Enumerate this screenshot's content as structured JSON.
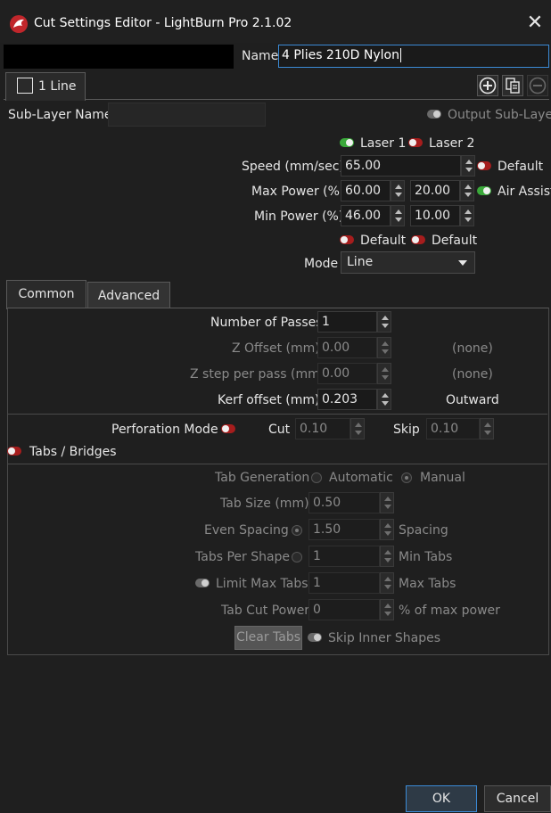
{
  "window": {
    "title": "Cut Settings Editor - LightBurn Pro 2.1.02",
    "close_glyph": "✕"
  },
  "header": {
    "name_label": "Name",
    "name_value": "4 Plies 210D Nylon"
  },
  "layer_tab": {
    "label": "1 Line"
  },
  "sublayer": {
    "name_label": "Sub-Layer Name",
    "name_value": "",
    "output_label": "Output Sub-Layer"
  },
  "lasers": {
    "laser1_label": "Laser 1",
    "laser2_label": "Laser 2"
  },
  "speed": {
    "label": "Speed (mm/sec)",
    "value": "65.00",
    "default_label": "Default"
  },
  "max_power": {
    "label": "Max Power (%)",
    "value1": "60.00",
    "value2": "20.00",
    "air_assist_label": "Air Assist"
  },
  "min_power": {
    "label": "Min Power (%)",
    "value1": "46.00",
    "value2": "10.00"
  },
  "defaults_row": {
    "default1_label": "Default",
    "default2_label": "Default"
  },
  "mode": {
    "label": "Mode",
    "value": "Line"
  },
  "tabs": [
    {
      "label": "Common"
    },
    {
      "label": "Advanced"
    }
  ],
  "common": {
    "passes_label": "Number of Passes",
    "passes_value": "1",
    "z_offset_label": "Z Offset (mm)",
    "z_offset_value": "0.00",
    "z_offset_note": "(none)",
    "z_step_label": "Z step per pass (mm)",
    "z_step_value": "0.00",
    "z_step_note": "(none)",
    "kerf_label": "Kerf offset (mm)",
    "kerf_value": "0.203",
    "kerf_note": "Outward",
    "perforation_label": "Perforation Mode",
    "cut_label": "Cut",
    "cut_value": "0.10",
    "skip_label": "Skip",
    "skip_value": "0.10",
    "tabs_bridges_label": "Tabs / Bridges",
    "tab_generation_label": "Tab Generation",
    "automatic_label": "Automatic",
    "manual_label": "Manual",
    "tab_size_label": "Tab Size (mm)",
    "tab_size_value": "0.50",
    "even_spacing_label": "Even Spacing",
    "even_spacing_value": "1.50",
    "spacing_label": "Spacing",
    "tabs_per_shape_label": "Tabs Per Shape",
    "tabs_per_shape_value": "1",
    "min_tabs_label": "Min Tabs",
    "limit_max_label": "Limit Max Tabs",
    "limit_max_value": "1",
    "max_tabs_label": "Max Tabs",
    "tab_cut_power_label": "Tab Cut Power",
    "tab_cut_power_value": "0",
    "pct_max_power_label": "% of max power",
    "clear_tabs_label": "Clear Tabs",
    "skip_inner_label": "Skip Inner Shapes"
  },
  "footer": {
    "ok_label": "OK",
    "cancel_label": "Cancel"
  },
  "colors": {
    "background": "#1f1f1f",
    "accent_focus": "#3b8ad6",
    "toggle_on": "#3aa83a",
    "toggle_off": "#a61d1d"
  }
}
